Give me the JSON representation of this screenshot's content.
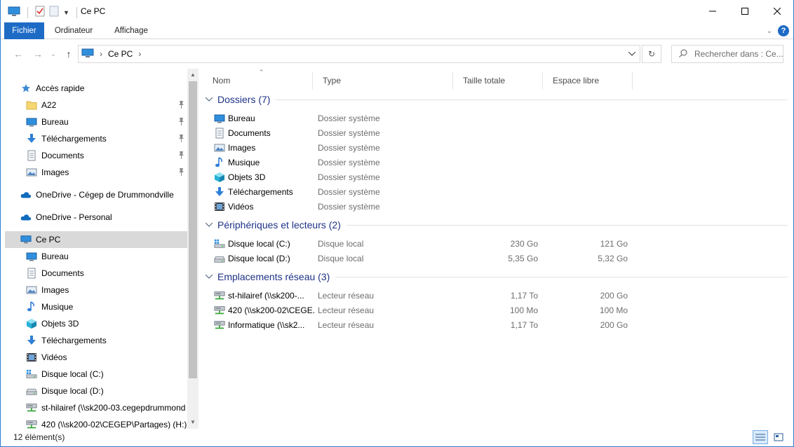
{
  "window": {
    "title": "Ce PC",
    "colors": {
      "accent": "#1e6bc6",
      "group_header": "#1e3287",
      "selection": "#d9d9d9"
    }
  },
  "ribbon": {
    "tabs": [
      {
        "label": "Fichier",
        "active": true
      },
      {
        "label": "Ordinateur",
        "active": false
      },
      {
        "label": "Affichage",
        "active": false
      }
    ],
    "help_label": "?"
  },
  "address": {
    "location": "Ce PC",
    "search_placeholder": "Rechercher dans : Ce..."
  },
  "navpane": {
    "items": [
      {
        "label": "Accès rapide",
        "icon": "star-icon",
        "indent": 1
      },
      {
        "label": "A22",
        "icon": "folder-icon",
        "indent": 2,
        "pinned": true
      },
      {
        "label": "Bureau",
        "icon": "desktop-icon",
        "indent": 2,
        "pinned": true
      },
      {
        "label": "Téléchargements",
        "icon": "download-icon",
        "indent": 2,
        "pinned": true
      },
      {
        "label": "Documents",
        "icon": "documents-icon",
        "indent": 2,
        "pinned": true
      },
      {
        "label": "Images",
        "icon": "pictures-icon",
        "indent": 2,
        "pinned": true
      },
      {
        "label": "OneDrive - Cégep de Drummondville",
        "icon": "cloud-icon",
        "indent": 1
      },
      {
        "label": "OneDrive - Personal",
        "icon": "cloud-icon",
        "indent": 1
      },
      {
        "label": "Ce PC",
        "icon": "computer-icon",
        "indent": 1,
        "selected": true
      },
      {
        "label": "Bureau",
        "icon": "desktop-icon",
        "indent": 2
      },
      {
        "label": "Documents",
        "icon": "documents-icon",
        "indent": 2
      },
      {
        "label": "Images",
        "icon": "pictures-icon",
        "indent": 2
      },
      {
        "label": "Musique",
        "icon": "music-icon",
        "indent": 2
      },
      {
        "label": "Objets 3D",
        "icon": "cube-icon",
        "indent": 2
      },
      {
        "label": "Téléchargements",
        "icon": "download-icon",
        "indent": 2
      },
      {
        "label": "Vidéos",
        "icon": "video-icon",
        "indent": 2
      },
      {
        "label": "Disque local (C:)",
        "icon": "windows-drive-icon",
        "indent": 2
      },
      {
        "label": "Disque local (D:)",
        "icon": "drive-icon",
        "indent": 2
      },
      {
        "label": "st-hilairef (\\\\sk200-03.cegepdrummond",
        "icon": "network-drive-icon",
        "indent": 2
      },
      {
        "label": "420 (\\\\sk200-02\\CEGEP\\Partages) (H:)",
        "icon": "network-drive-icon",
        "indent": 2
      }
    ]
  },
  "columns": {
    "name": "Nom",
    "type": "Type",
    "total_size": "Taille totale",
    "free_space": "Espace libre"
  },
  "groups": [
    {
      "title": "Dossiers (7)",
      "rows": [
        {
          "name": "Bureau",
          "icon": "desktop-icon",
          "type": "Dossier système",
          "size": "",
          "free": ""
        },
        {
          "name": "Documents",
          "icon": "documents-icon",
          "type": "Dossier système",
          "size": "",
          "free": ""
        },
        {
          "name": "Images",
          "icon": "pictures-icon",
          "type": "Dossier système",
          "size": "",
          "free": ""
        },
        {
          "name": "Musique",
          "icon": "music-icon",
          "type": "Dossier système",
          "size": "",
          "free": ""
        },
        {
          "name": "Objets 3D",
          "icon": "cube-icon",
          "type": "Dossier système",
          "size": "",
          "free": ""
        },
        {
          "name": "Téléchargements",
          "icon": "download-icon",
          "type": "Dossier système",
          "size": "",
          "free": ""
        },
        {
          "name": "Vidéos",
          "icon": "video-icon",
          "type": "Dossier système",
          "size": "",
          "free": ""
        }
      ]
    },
    {
      "title": "Périphériques et lecteurs (2)",
      "rows": [
        {
          "name": "Disque local (C:)",
          "icon": "windows-drive-icon",
          "type": "Disque local",
          "size": "230 Go",
          "free": "121 Go"
        },
        {
          "name": "Disque local (D:)",
          "icon": "drive-icon",
          "type": "Disque local",
          "size": "5,35 Go",
          "free": "5,32 Go"
        }
      ]
    },
    {
      "title": "Emplacements réseau (3)",
      "rows": [
        {
          "name": "st-hilairef (\\\\sk200-...",
          "icon": "network-drive-icon",
          "type": "Lecteur réseau",
          "size": "1,17 To",
          "free": "200 Go"
        },
        {
          "name": "420 (\\\\sk200-02\\CEGE...",
          "icon": "network-drive-icon",
          "type": "Lecteur réseau",
          "size": "100 Mo",
          "free": "100 Mo"
        },
        {
          "name": "Informatique (\\\\sk2...",
          "icon": "network-drive-icon",
          "type": "Lecteur réseau",
          "size": "1,17 To",
          "free": "200 Go"
        }
      ]
    }
  ],
  "status": {
    "item_count": "12 élément(s)"
  }
}
